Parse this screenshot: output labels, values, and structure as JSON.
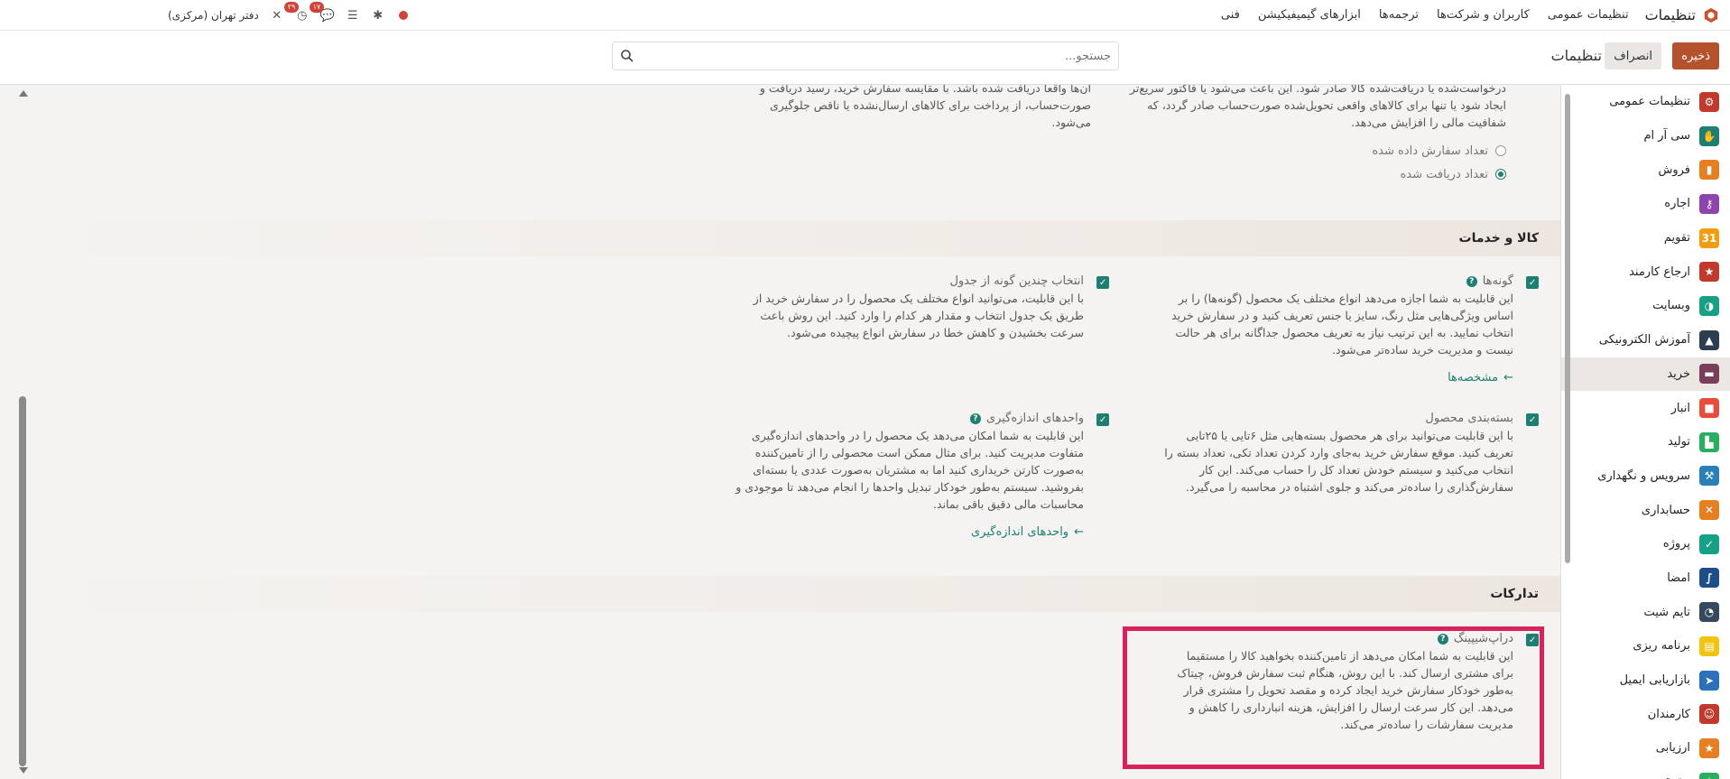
{
  "topbar": {
    "app_title": "تنظیمات",
    "menu": [
      "تنظیمات عمومی",
      "کاربران و شرکت‌ها",
      "ترجمه‌ها",
      "ابزارهای گیمیفیکیشن",
      "فنی"
    ],
    "badges": {
      "activity": "۲۹",
      "messages": "۱۷"
    },
    "company": "دفتر تهران (مرکزی)"
  },
  "control": {
    "save": "ذخیره",
    "discard": "انصراف",
    "title": "تنظیمات",
    "search_placeholder": "جستجو..."
  },
  "sidebar": {
    "items": [
      {
        "label": "تنظیمات عمومی",
        "icon": "settings-icon",
        "color": "#c0392b"
      },
      {
        "label": "سی آر ام",
        "icon": "handshake-icon",
        "color": "#1d7f71"
      },
      {
        "label": "فروش",
        "icon": "chart-icon",
        "color": "#e67e22"
      },
      {
        "label": "اجاره",
        "icon": "key-icon",
        "color": "#8e44ad"
      },
      {
        "label": "تقویم",
        "icon": "calendar-icon",
        "color": "#f39c12"
      },
      {
        "label": "ارجاع کارمند",
        "icon": "star-badge-icon",
        "color": "#c0392b"
      },
      {
        "label": "وبسایت",
        "icon": "globe-icon",
        "color": "#16a085"
      },
      {
        "label": "آموزش الکترونیکی",
        "icon": "graduation-icon",
        "color": "#2c3e50"
      },
      {
        "label": "خرید",
        "icon": "card-icon",
        "color": "#7a3e5b"
      },
      {
        "label": "انبار",
        "icon": "box-icon",
        "color": "#e74c3c"
      },
      {
        "label": "تولید",
        "icon": "factory-icon",
        "color": "#27ae60"
      },
      {
        "label": "سرویس و نگهداری",
        "icon": "wrench-icon",
        "color": "#2980b9"
      },
      {
        "label": "حسابداری",
        "icon": "accounting-icon",
        "color": "#e67e22"
      },
      {
        "label": "پروژه",
        "icon": "check-icon",
        "color": "#16a085"
      },
      {
        "label": "امضا",
        "icon": "signature-icon",
        "color": "#1d4e89"
      },
      {
        "label": "تایم شیت",
        "icon": "clock-icon",
        "color": "#34495e"
      },
      {
        "label": "برنامه ریزی",
        "icon": "planning-icon",
        "color": "#f1c40f"
      },
      {
        "label": "بازاریابی ایمیل",
        "icon": "paper-plane-icon",
        "color": "#2c6fbb"
      },
      {
        "label": "کارمندان",
        "icon": "people-icon",
        "color": "#c0392b"
      },
      {
        "label": "ارزیابی",
        "icon": "star-icon",
        "color": "#e67e22"
      },
      {
        "label": "حقوق و دستمزد",
        "icon": "payroll-icon",
        "color": "#27ae60"
      }
    ],
    "active_index": 8
  },
  "top_section": {
    "left_desc": "آن‌ها واقعاً دریافت شده باشد. با مقایسه سفارش خرید، رسید دریافت و صورت‌حساب، از پرداخت برای کالاهای ارسال‌نشده یا ناقص جلوگیری می‌شود.",
    "right_desc": "درخواست‌شده یا دریافت‌شده کالا صادر شود. این باعث می‌شود یا فاکتور سریع‌تر ایجاد شود یا تنها برای کالاهای واقعی تحویل‌شده صورت‌حساب صادر گردد، که شفافیت مالی را افزایش می‌دهد.",
    "radio_ordered": "تعداد سفارش داده شده",
    "radio_received": "تعداد دریافت شده"
  },
  "products": {
    "title": "کالا و خدمات",
    "variants": {
      "title": "گونه‌ها",
      "desc": "این قابلیت به شما اجازه می‌دهد انواع مختلف یک محصول (گونه‌ها) را بر اساس ویژگی‌هایی مثل رنگ، سایز یا جنس تعریف کنید و در سفارش خرید انتخاب نمایید. به این ترتیب نیاز به تعریف محصول جداگانه برای هر حالت نیست و مدیریت خرید ساده‌تر می‌شود.",
      "link": "مشخصه‌ها"
    },
    "grid": {
      "title": "انتخاب چندین گونه از جدول",
      "desc": "با این قابلیت، می‌توانید انواع مختلف یک محصول را در سفارش خرید از طریق یک جدول انتخاب و مقدار هر کدام را وارد کنید. این روش باعث سرعت بخشیدن و کاهش خطا در سفارش انواع پیچیده می‌شود."
    },
    "packaging": {
      "title": "بسته‌بندی محصول",
      "desc": "با این قابلیت می‌توانید برای هر محصول بسته‌هایی مثل ۶تایی یا ۲۵تایی تعریف کنید. موقع سفارش خرید به‌جای وارد کردن تعداد تکی، تعداد بسته را انتخاب می‌کنید و سیستم خودش تعداد کل را حساب می‌کند. این کار سفارش‌گذاری را ساده‌تر می‌کند و جلوی اشتباه در محاسبه را می‌گیرد."
    },
    "uom": {
      "title": "واحدهای اندازه‌گیری",
      "desc": "این قابلیت به شما امکان می‌دهد یک محصول را در واحدهای اندازه‌گیری متفاوت مدیریت کنید. برای مثال ممکن است محصولی را از تامین‌کننده به‌صورت کارتن خریداری کنید اما به مشتریان به‌صورت عددی یا بسته‌ای بفروشید. سیستم به‌طور خودکار تبدیل واحدها را انجام می‌دهد تا موجودی و محاسبات مالی دقیق باقی بماند.",
      "link": "واحدهای اندازه‌گیری"
    }
  },
  "logistics": {
    "title": "تدارکات",
    "dropship": {
      "title": "دراپ‌شیپینگ",
      "desc": "این قابلیت به شما امکان می‌دهد از تامین‌کننده بخواهید کالا را مستقیما برای مشتری ارسال کند. با این روش، هنگام ثبت سفارش فروش، چیتاک به‌طور خودکار سفارش خرید ایجاد کرده و مقصد تحویل را مشتری قرار می‌دهد. این کار سرعت ارسال را افزایش، هزینه انبارداری را کاهش و مدیریت سفارشات را ساده‌تر می‌کند."
    }
  },
  "colors": {
    "accent": "#1d7f71",
    "save": "#b5522e",
    "highlight": "#d6245a"
  }
}
